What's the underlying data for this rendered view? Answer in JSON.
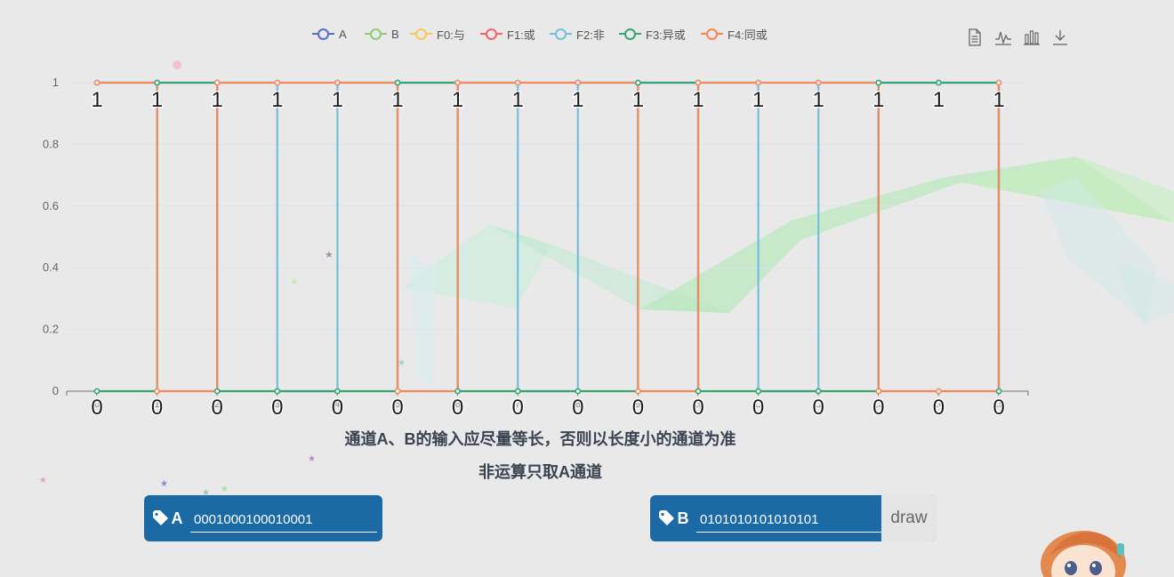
{
  "legend": [
    {
      "name": "A",
      "color": "#5470c6"
    },
    {
      "name": "B",
      "color": "#91cc75"
    },
    {
      "name": "F0:与",
      "color": "#fac858"
    },
    {
      "name": "F1:或",
      "color": "#ee6666"
    },
    {
      "name": "F2:非",
      "color": "#73c0de"
    },
    {
      "name": "F3:异或",
      "color": "#3ba272"
    },
    {
      "name": "F4:同或",
      "color": "#fc8452"
    }
  ],
  "toolbox": [
    "data-view-icon",
    "line-chart-icon",
    "bar-chart-icon",
    "download-icon"
  ],
  "chart_data": {
    "type": "line",
    "step": true,
    "ylim": [
      0,
      1
    ],
    "yticks": [
      "0",
      "0.2",
      "0.4",
      "0.6",
      "0.8",
      "1"
    ],
    "x": [
      "0",
      "1",
      "2",
      "3",
      "4",
      "5",
      "6",
      "7",
      "8",
      "9",
      "10",
      "11",
      "12",
      "13",
      "14",
      "15"
    ],
    "grid": true,
    "legend_position": "top-center",
    "point_label_note": "each point labeled with its value (1 above top, 0 below bottom)",
    "series": [
      {
        "name": "F2:非",
        "color": "#73c0de",
        "values": [
          1,
          1,
          1,
          0,
          1,
          1,
          1,
          0,
          1,
          1,
          1,
          0,
          1,
          1,
          1,
          0
        ]
      },
      {
        "name": "F3:异或",
        "color": "#3ba272",
        "values": [
          0,
          1,
          0,
          0,
          0,
          1,
          0,
          0,
          0,
          1,
          0,
          0,
          0,
          1,
          1,
          0
        ]
      },
      {
        "name": "F4:同或",
        "color": "#f08a5d",
        "values": [
          1,
          0,
          1,
          1,
          1,
          0,
          1,
          1,
          1,
          0,
          1,
          1,
          1,
          0,
          0,
          1
        ]
      }
    ],
    "labels_top": [
      "1",
      "1",
      "1",
      "1",
      "1",
      "1",
      "1",
      "1",
      "1",
      "1",
      "1",
      "1",
      "1",
      "1",
      "1",
      "1"
    ],
    "labels_bottom": [
      "0",
      "0",
      "0",
      "0",
      "0",
      "0",
      "0",
      "0",
      "0",
      "0",
      "0",
      "0",
      "0",
      "0",
      "0",
      "0"
    ]
  },
  "notes": {
    "line1": "通道A、B的输入应尽量等长，否则以长度小的通道为准",
    "line2": "非运算只取A通道"
  },
  "inputs": {
    "a_label": "A",
    "a_value": "0001000100010001",
    "b_label": "B",
    "b_value": "0101010101010101",
    "draw_label": "draw"
  },
  "colors": {
    "panel": "#1b69a5",
    "background": "#e9e9ea"
  }
}
